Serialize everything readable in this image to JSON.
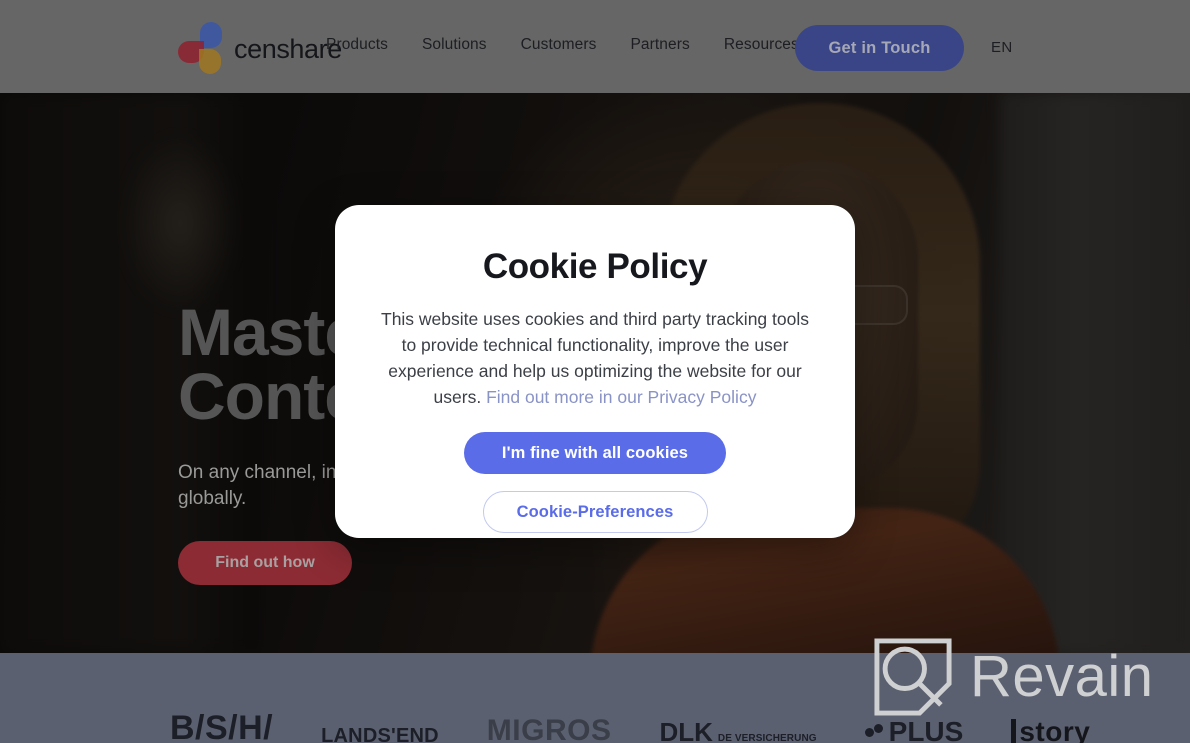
{
  "header": {
    "logo_text": "censhare",
    "logo_icon": "censhare-petals-logo",
    "nav": [
      {
        "label": "Products"
      },
      {
        "label": "Solutions"
      },
      {
        "label": "Customers"
      },
      {
        "label": "Partners"
      },
      {
        "label": "Resources"
      }
    ],
    "cta_label": "Get in Touch",
    "language": "EN",
    "colors": {
      "header_bg": "#666666",
      "cta_bg": "#3a4587",
      "logo_blue": "#3a57a8",
      "logo_red": "#8f2230",
      "logo_gold": "#a07722"
    }
  },
  "hero": {
    "title": "Maste\nConten",
    "subtitle": "On any channel, in\nglobally.",
    "button_label": "Find out how",
    "button_color": "#8c2b33"
  },
  "modal": {
    "title": "Cookie Policy",
    "body_text": "This website uses cookies and third party tracking tools to provide technical functionality, improve the user experience and help us optimizing the website for our users. ",
    "link_label": "Find out more in our Privacy Policy",
    "accept_label": "I'm fine with all cookies",
    "preferences_label": "Cookie-Preferences",
    "colors": {
      "primary": "#5a6ce8",
      "link": "#8a93c6",
      "surface": "#ffffff"
    }
  },
  "logo_strip": {
    "background": "#5b6070",
    "brands": [
      {
        "label": "B/S/H/"
      },
      {
        "label": "LANDS'END"
      },
      {
        "label": "MIGROS"
      },
      {
        "label": "DLK",
        "sub": "DE VERSICHERUNG"
      },
      {
        "label": "PLUS"
      },
      {
        "label": "story"
      }
    ]
  },
  "watermark": {
    "label": "Revain",
    "icon": "revain-logo-icon"
  }
}
